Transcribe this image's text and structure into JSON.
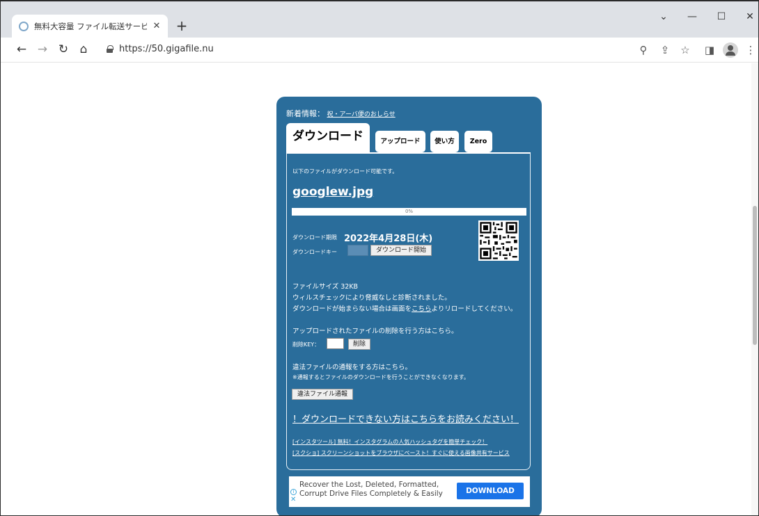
{
  "browser": {
    "tab_title": "無料大容量 ファイル転送サービス Gi",
    "url": "https://50.gigafile.nu"
  },
  "page": {
    "news_label": "新着情報：",
    "news_link": "祝・アーバ便のおしらせ",
    "tabs": [
      {
        "label": "ダウンロード",
        "active": true
      },
      {
        "label": "アップロード",
        "active": false
      },
      {
        "label": "使い方",
        "active": false
      },
      {
        "label": "Zero",
        "active": false
      }
    ],
    "intro_text": "以下のファイルがダウンロード可能です。",
    "file_name": "googlew.jpg",
    "progress_text": "0%",
    "progress_value": 0,
    "deadline_label": "ダウンロード期限",
    "deadline_value": "2022年4月28日(木)",
    "dl_key_label": "ダウンロードキー",
    "dl_key_value": "",
    "dl_start_button": "ダウンロード開始",
    "file_size": "ファイルサイズ 32KB",
    "virus_check": "ウィルスチェックにより脅威なしと診断されました。",
    "reload_prefix": "ダウンロードが始まらない場合は画面を",
    "reload_link": "こちら",
    "reload_suffix": "よりリロードしてください。",
    "delete_intro": "アップロードされたファイルの削除を行う方はこちら。",
    "delete_key_label": "削除KEY：",
    "delete_key_value": "",
    "delete_button": "削除",
    "report_intro": "違法ファイルの通報をする方はこちら。",
    "report_note": "※通報するとファイルのダウンロードを行うことができなくなります。",
    "report_button": "違法ファイル通報",
    "help_link": "！ダウンロードできない方はこちらをお読みください！",
    "promo_links": [
      "[インスタツール] 無料！インスタグラムの人気ハッシュタグを簡単チェック！",
      "[スクショ] スクリーンショットをブラウザにペースト！すぐに使える画像共有サービス"
    ]
  },
  "ad": {
    "line1": "Recover the Lost, Deleted, Formatted,",
    "line2": "Corrupt Drive Files Completely & Easily",
    "button": "DOWNLOAD"
  },
  "colors": {
    "card": "#2a6d9b",
    "ad_button": "#1a73e8"
  }
}
